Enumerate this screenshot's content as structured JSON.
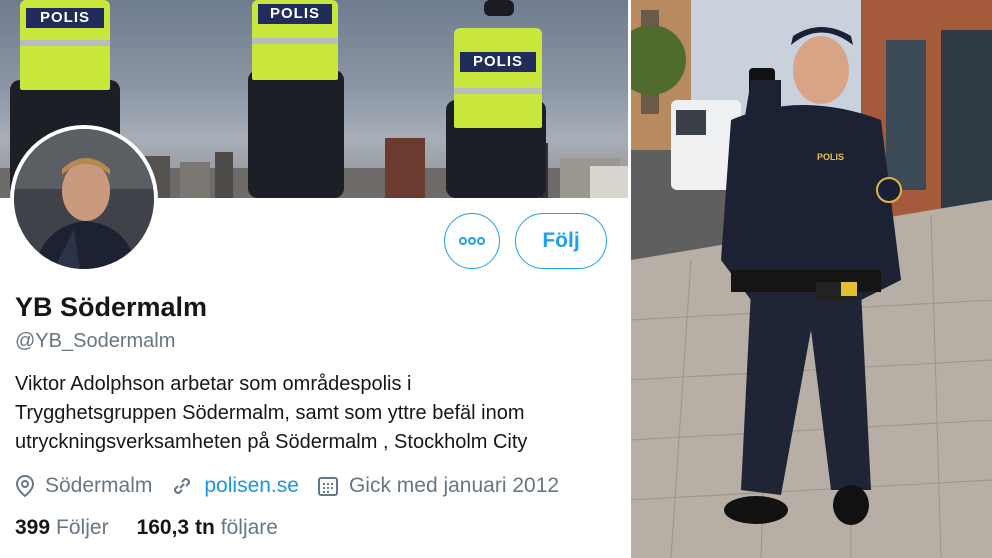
{
  "profile": {
    "banner_tag": "POLIS",
    "name": "YB Södermalm",
    "handle": "@YB_Sodermalm",
    "bio_lines": [
      "Viktor Adolphson arbetar som områdespolis i",
      "Trygghetsgruppen Södermalm, samt som yttre befäl inom",
      "utryckningsverksamheten på Södermalm , Stockholm City"
    ],
    "location": "Södermalm",
    "website": "polisen.se",
    "joined": "Gick med januari 2012",
    "following_count": "399",
    "following_label": "Följer",
    "followers_count": "160,3 tn",
    "followers_label": "följare"
  },
  "actions": {
    "more_icon": "more-dots-icon",
    "follow_label": "Följ"
  },
  "photo": {
    "badge_text": "POLIS"
  },
  "colors": {
    "accent": "#1da1f2",
    "link": "#1b95e0",
    "text": "#14171a",
    "muted": "#657786",
    "vest": "#c8e63c",
    "uniform": "#1c2233"
  }
}
